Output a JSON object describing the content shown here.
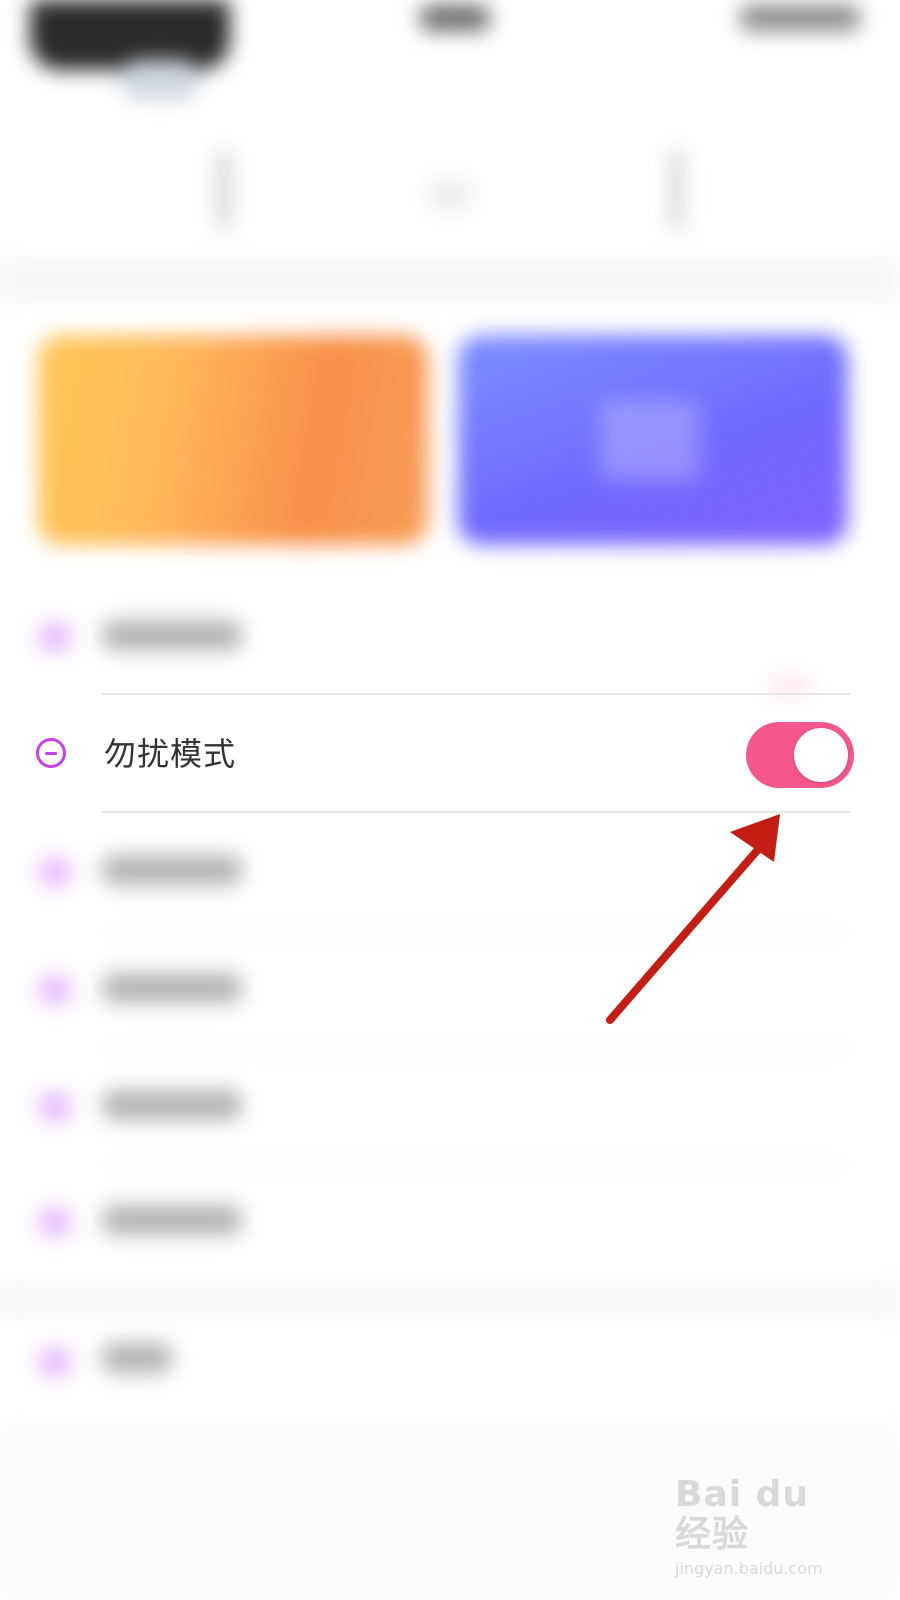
{
  "settings_row": {
    "label": "勿扰模式",
    "toggle_on": true
  },
  "watermark": {
    "main": "Bai du 经验",
    "sub": "jingyan.baidu.com"
  },
  "colors": {
    "accent": "#f6578a",
    "icon": "#c840e9",
    "arrow": "#c41e14"
  },
  "icons": {
    "dnd": "minus-circle-icon"
  }
}
